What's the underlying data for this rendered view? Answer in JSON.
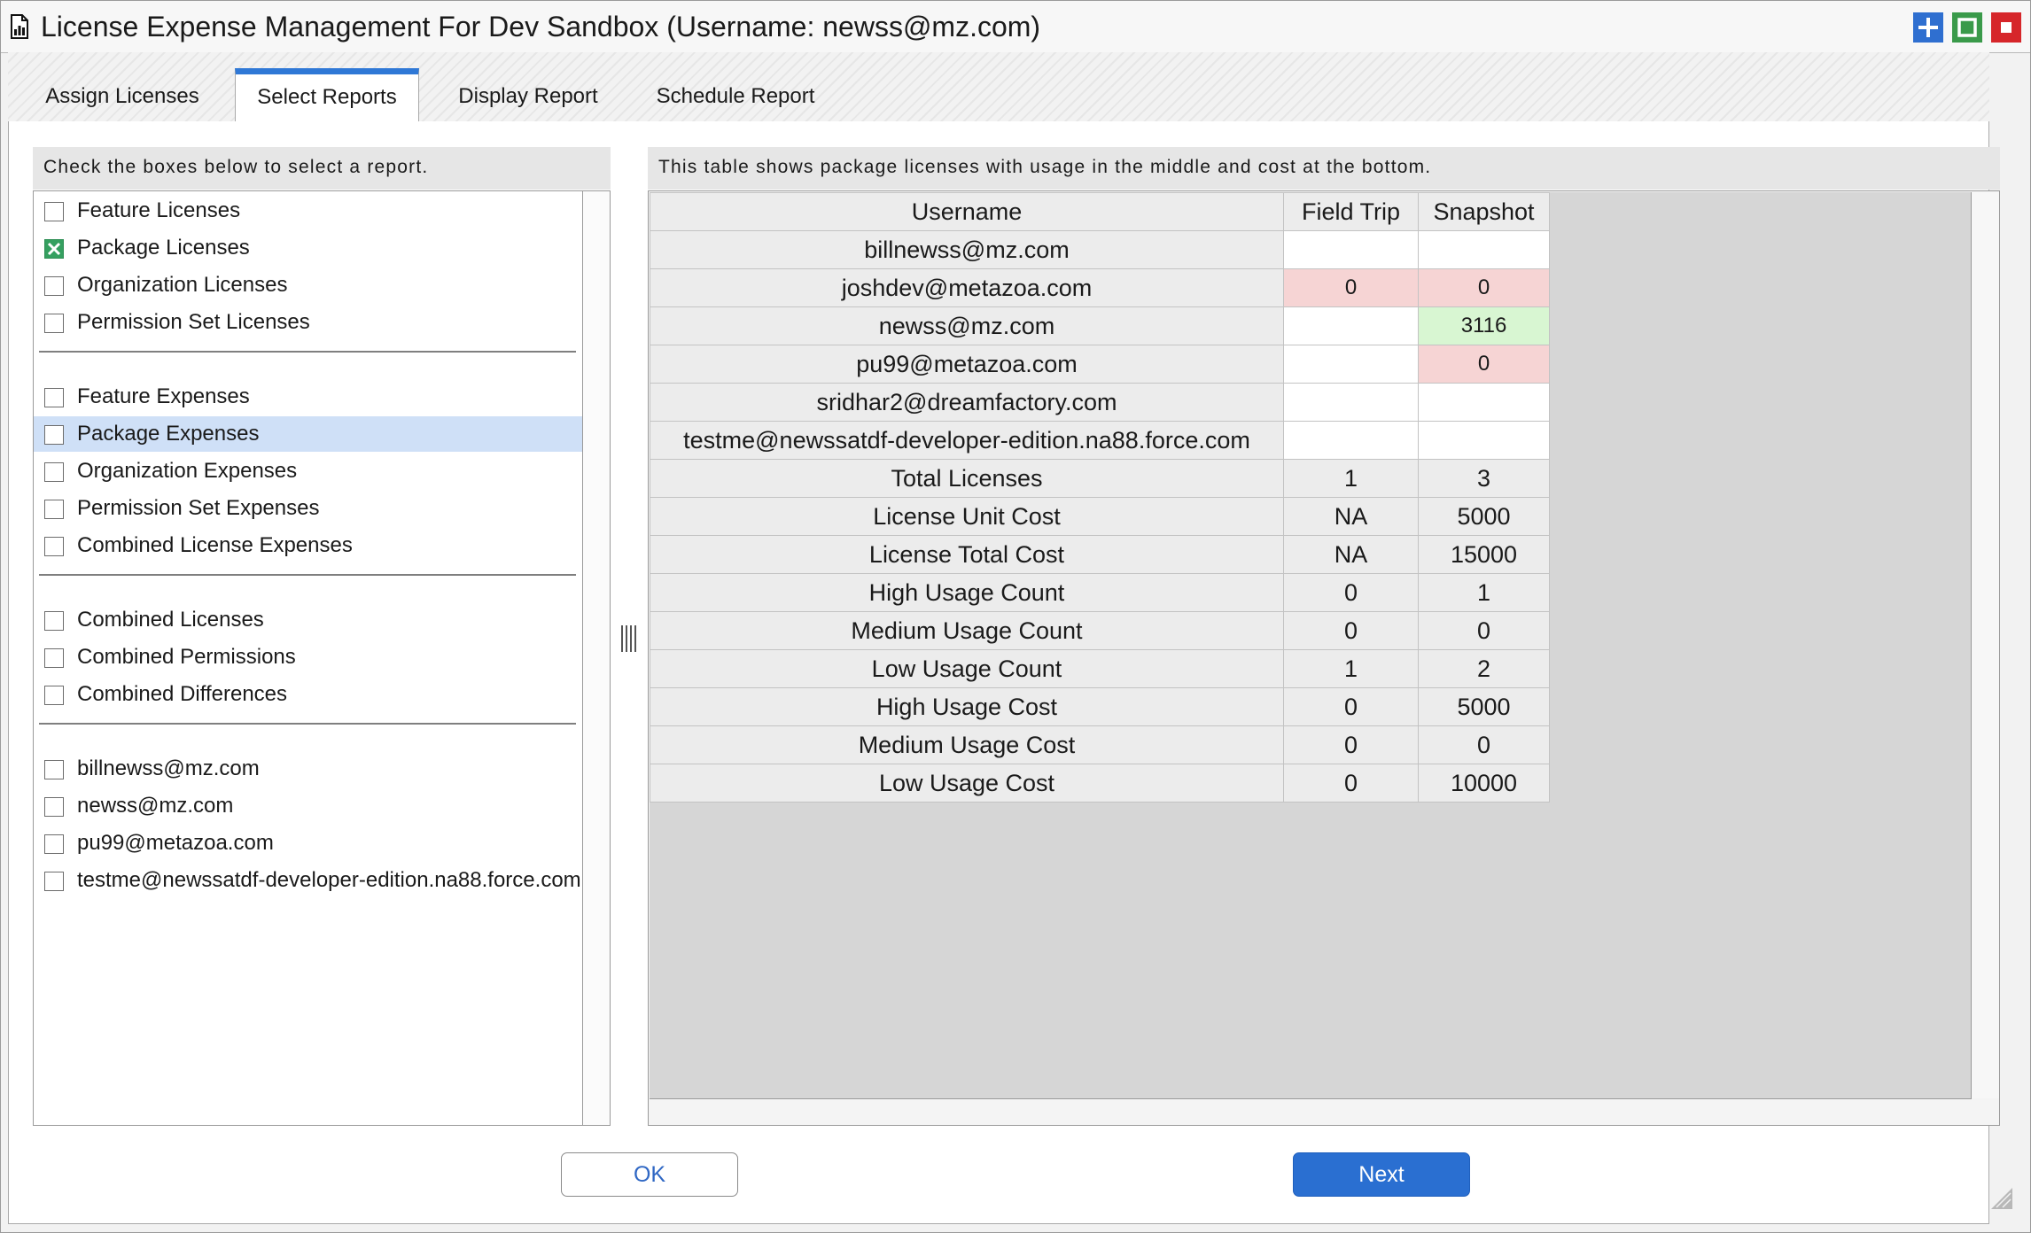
{
  "window": {
    "title": "License Expense Management For Dev Sandbox (Username: newss@mz.com)",
    "controls": [
      "add",
      "maximize",
      "close"
    ],
    "colors": {
      "add": "#2f6fd0",
      "maximize": "#3a9a4a",
      "close": "#d6262a"
    }
  },
  "tabs": [
    {
      "label": "Assign Licenses",
      "active": false
    },
    {
      "label": "Select Reports",
      "active": true
    },
    {
      "label": "Display Report",
      "active": false
    },
    {
      "label": "Schedule Report",
      "active": false
    }
  ],
  "left_panel": {
    "header": "Check the boxes below to select a report.",
    "groups": [
      [
        {
          "label": "Feature Licenses",
          "checked": false
        },
        {
          "label": "Package Licenses",
          "checked": true
        },
        {
          "label": "Organization Licenses",
          "checked": false
        },
        {
          "label": "Permission Set Licenses",
          "checked": false
        }
      ],
      [
        {
          "label": "Feature Expenses",
          "checked": false
        },
        {
          "label": "Package Expenses",
          "checked": false,
          "selected": true
        },
        {
          "label": "Organization Expenses",
          "checked": false
        },
        {
          "label": "Permission Set Expenses",
          "checked": false
        },
        {
          "label": "Combined License Expenses",
          "checked": false
        }
      ],
      [
        {
          "label": "Combined Licenses",
          "checked": false
        },
        {
          "label": "Combined Permissions",
          "checked": false
        },
        {
          "label": "Combined Differences",
          "checked": false
        }
      ],
      [
        {
          "label": "billnewss@mz.com",
          "checked": false
        },
        {
          "label": "newss@mz.com",
          "checked": false
        },
        {
          "label": "pu99@metazoa.com",
          "checked": false
        },
        {
          "label": "testme@newssatdf-developer-edition.na88.force.com",
          "checked": false
        }
      ]
    ]
  },
  "right_panel": {
    "header": "This table shows package licenses with usage in the middle and cost at the bottom.",
    "table": {
      "columns": [
        "Username",
        "Field Trip",
        "Snapshot"
      ],
      "user_rows": [
        {
          "username": "billnewss@mz.com",
          "field_trip": "",
          "snapshot": "",
          "ft_state": "white",
          "sn_state": "white"
        },
        {
          "username": "joshdev@metazoa.com",
          "field_trip": "0",
          "snapshot": "0",
          "ft_state": "red",
          "sn_state": "red"
        },
        {
          "username": "newss@mz.com",
          "field_trip": "",
          "snapshot": "3116",
          "ft_state": "white",
          "sn_state": "green"
        },
        {
          "username": "pu99@metazoa.com",
          "field_trip": "",
          "snapshot": "0",
          "ft_state": "white",
          "sn_state": "red"
        },
        {
          "username": "sridhar2@dreamfactory.com",
          "field_trip": "",
          "snapshot": "",
          "ft_state": "white",
          "sn_state": "white"
        },
        {
          "username": "testme@newssatdf-developer-edition.na88.force.com",
          "field_trip": "",
          "snapshot": "",
          "ft_state": "white",
          "sn_state": "white"
        }
      ],
      "summary_rows": [
        {
          "label": "Total Licenses",
          "field_trip": "1",
          "snapshot": "3"
        },
        {
          "label": "License Unit Cost",
          "field_trip": "NA",
          "snapshot": "5000"
        },
        {
          "label": "License Total Cost",
          "field_trip": "NA",
          "snapshot": "15000"
        },
        {
          "label": "High Usage Count",
          "field_trip": "0",
          "snapshot": "1"
        },
        {
          "label": "Medium Usage Count",
          "field_trip": "0",
          "snapshot": "0"
        },
        {
          "label": "Low Usage Count",
          "field_trip": "1",
          "snapshot": "2"
        },
        {
          "label": "High Usage Cost",
          "field_trip": "0",
          "snapshot": "5000"
        },
        {
          "label": "Medium Usage Cost",
          "field_trip": "0",
          "snapshot": "0"
        },
        {
          "label": "Low Usage Cost",
          "field_trip": "0",
          "snapshot": "10000"
        }
      ]
    }
  },
  "buttons": {
    "ok": "OK",
    "next": "Next"
  }
}
